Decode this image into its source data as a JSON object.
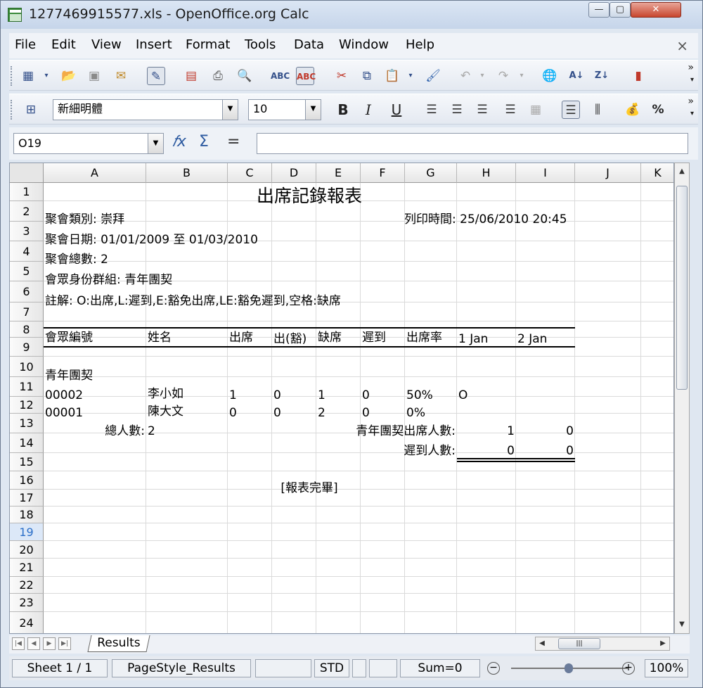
{
  "window": {
    "title": "1277469915577.xls - OpenOffice.org Calc",
    "min": "—",
    "max": "▢",
    "close": "✕"
  },
  "menu": [
    "File",
    "Edit",
    "View",
    "Insert",
    "Format",
    "Tools",
    "Data",
    "Window",
    "Help"
  ],
  "menu_close": "×",
  "toolbar2": {
    "font": "新細明體",
    "size": "10",
    "bold": "B",
    "italic": "I",
    "underline": "U",
    "percent": "%"
  },
  "formula": {
    "cellref": "O19",
    "fx": "𝑓x",
    "sum": "Σ",
    "equals": "=",
    "value": ""
  },
  "columns": [
    "A",
    "B",
    "C",
    "D",
    "E",
    "F",
    "G",
    "H",
    "I",
    "J",
    "K"
  ],
  "rows": [
    "1",
    "2",
    "3",
    "4",
    "5",
    "6",
    "7",
    "8",
    "9",
    "10",
    "11",
    "12",
    "13",
    "14",
    "15",
    "16",
    "17",
    "18",
    "19",
    "20",
    "21",
    "22",
    "23",
    "24"
  ],
  "cells": {
    "title": "出席記錄報表",
    "a2": "聚會類別: 崇拜",
    "g2": "列印時間: 25/06/2010 20:45",
    "a3": "聚會日期: 01/01/2009 至 01/03/2010",
    "a4": "聚會總數: 2",
    "a5": "會眾身份群組: 青年團契",
    "a6": "註解: O:出席,L:遲到,E:豁免出席,LE:豁免遲到,空格:缺席",
    "h8": [
      "會眾編號",
      "姓名",
      "出席",
      "出(豁)",
      "缺席",
      "遲到",
      "出席率",
      "1 Jan",
      "2 Jan"
    ],
    "a10": "青年團契",
    "r11": [
      "00002",
      "李小如",
      "1",
      "0",
      "1",
      "0",
      "50%",
      "O"
    ],
    "r12": [
      "00001",
      "陳大文",
      "0",
      "0",
      "2",
      "0",
      "0%"
    ],
    "a13": "總人數:",
    "b13": "2",
    "g13": "青年團契出席人數:",
    "h13": "1",
    "i13": "0",
    "g14": "遲到人數:",
    "h14": "0",
    "i14": "0",
    "r16": "[報表完畢]"
  },
  "sheet_tab": "Results",
  "status": {
    "sheet": "Sheet 1 / 1",
    "pagestyle": "PageStyle_Results",
    "mode": "STD",
    "sum": "Sum=0",
    "zoom": "100%"
  }
}
